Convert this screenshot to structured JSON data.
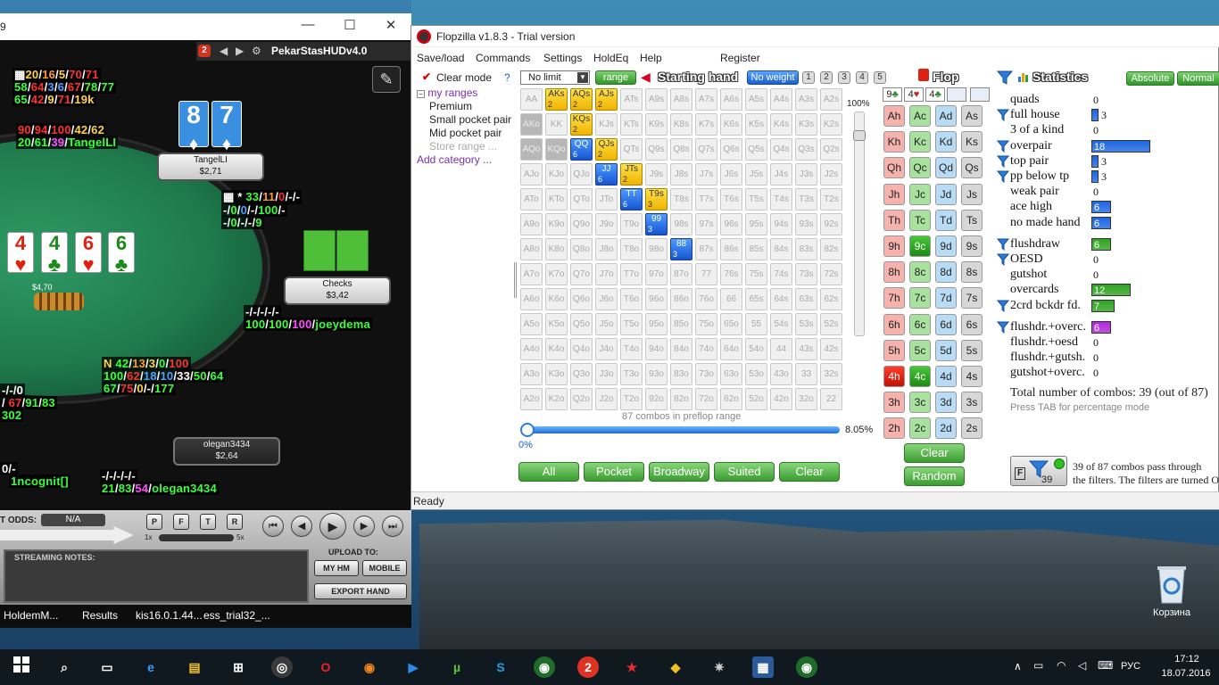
{
  "holdem_manager": {
    "title_fragment": "9",
    "hud_name": "PekarStasHUDv4.0",
    "hud_badge": "2",
    "top_stats": {
      "l1": [
        "20",
        "16",
        "5",
        "70",
        "71"
      ],
      "l2": [
        "58",
        "64",
        "3",
        "6",
        "67",
        "78",
        "77"
      ],
      "l3": [
        "65",
        "42",
        "9",
        "71",
        "19k"
      ]
    },
    "tangel_stats": {
      "l1": [
        "90",
        "94",
        "100",
        "42",
        "62"
      ],
      "l2": [
        "20",
        "61",
        "39",
        "TangelLI"
      ]
    },
    "tangel_plate": {
      "name": "TangelLI",
      "stack": "$2,71"
    },
    "board_cards": [
      {
        "rank": "8",
        "suit": "♦"
      },
      {
        "rank": "7",
        "suit": "♦"
      }
    ],
    "player_cards": [
      {
        "rank": "4",
        "suit": "♥"
      },
      {
        "rank": "4",
        "suit": "♣"
      },
      {
        "rank": "6",
        "suit": "♥"
      },
      {
        "rank": "6",
        "suit": "♣"
      }
    ],
    "joey_stats": {
      "l1": [
        "*",
        "33",
        "11",
        "0",
        "-",
        "-"
      ],
      "l2": [
        "-",
        "/",
        "0",
        "/",
        "0",
        "/",
        "-",
        "/",
        "100",
        "/",
        "-"
      ],
      "l3": [
        "-",
        "/",
        "0",
        "/",
        "-",
        "/",
        "-",
        "/",
        "9"
      ]
    },
    "joey_plate": {
      "status": "Checks",
      "stack": "$3,42"
    },
    "joey_stats2": {
      "l1": "-/-/-/-/-",
      "l2": [
        "100",
        "100",
        "100",
        "joeydema"
      ]
    },
    "pot": "$4,70",
    "olegan_hud": {
      "l1": [
        "42",
        "13",
        "3",
        "0",
        "100"
      ],
      "l2": [
        "100",
        "62",
        "18",
        "10",
        "33",
        "50",
        "64"
      ],
      "l3": [
        "67",
        "75",
        "0",
        "-",
        "177"
      ]
    },
    "left_stats": {
      "l1": "-/-/0",
      "l2": [
        "67",
        "91",
        "83"
      ],
      "l3": "302",
      "l4": "0/-",
      "l5": "1ncognit[]"
    },
    "olegan_plate": {
      "name": "olegan3434",
      "stack": "$2,64"
    },
    "olegan_stats2": {
      "l1": "-/-/-/-/-",
      "l2": [
        "21",
        "83",
        "54",
        "olegan3434"
      ]
    },
    "controls": {
      "pot_odds_label": "T ODDS:",
      "pot_odds": "N/A",
      "p": "P",
      "f": "F",
      "t": "T",
      "r": "R",
      "speed_min": "1x",
      "speed_max": "5x"
    },
    "notes_title": "STREAMING NOTES:",
    "upload_title": "UPLOAD TO:",
    "buttons": {
      "my_hm": "MY HM",
      "mobile": "MOBILE",
      "export": "EXPORT HAND"
    },
    "tabs": [
      "HoldemM...",
      "Results",
      "kis16.0.1.44...",
      "ess_trial32_..."
    ]
  },
  "flopzilla": {
    "title": "Flopzilla v1.8.3 - Trial version",
    "menu": [
      "Save/load",
      "Commands",
      "Settings",
      "HoldEq",
      "Help",
      "Register"
    ],
    "clear_mode": "Clear mode",
    "help_q": "?",
    "limit": "No limit",
    "range_btn": "range",
    "starting_hand": "Starting hand",
    "no_weight": "No weight",
    "weights": [
      "1",
      "2",
      "3",
      "4",
      "5"
    ],
    "tree": [
      "my ranges",
      "Premium",
      "Small pocket pair",
      "Mid pocket pair",
      "Store range ...",
      "Add category ..."
    ],
    "grid": [
      [
        "AA",
        "AKs",
        "AQs",
        "AJs",
        "ATs",
        "A9s",
        "A8s",
        "A7s",
        "A6s",
        "A5s",
        "A4s",
        "A3s",
        "A2s"
      ],
      [
        "AKo",
        "KK",
        "KQs",
        "KJs",
        "KTs",
        "K9s",
        "K8s",
        "K7s",
        "K6s",
        "K5s",
        "K4s",
        "K3s",
        "K2s"
      ],
      [
        "AQo",
        "KQo",
        "QQ",
        "QJs",
        "QTs",
        "Q9s",
        "Q8s",
        "Q7s",
        "Q6s",
        "Q5s",
        "Q4s",
        "Q3s",
        "Q2s"
      ],
      [
        "AJo",
        "KJo",
        "QJo",
        "JJ",
        "JTs",
        "J9s",
        "J8s",
        "J7s",
        "J6s",
        "J5s",
        "J4s",
        "J3s",
        "J2s"
      ],
      [
        "ATo",
        "KTo",
        "QTo",
        "JTo",
        "TT",
        "T9s",
        "T8s",
        "T7s",
        "T6s",
        "T5s",
        "T4s",
        "T3s",
        "T2s"
      ],
      [
        "A9o",
        "K9o",
        "Q9o",
        "J9o",
        "T9o",
        "99",
        "98s",
        "97s",
        "96s",
        "95s",
        "94s",
        "93s",
        "92s"
      ],
      [
        "A8o",
        "K8o",
        "Q8o",
        "J8o",
        "T8o",
        "98o",
        "88",
        "87s",
        "86s",
        "85s",
        "84s",
        "83s",
        "82s"
      ],
      [
        "A7o",
        "K7o",
        "Q7o",
        "J7o",
        "T7o",
        "97o",
        "87o",
        "77",
        "76s",
        "75s",
        "74s",
        "73s",
        "72s"
      ],
      [
        "A6o",
        "K6o",
        "Q6o",
        "J6o",
        "T6o",
        "96o",
        "86o",
        "76o",
        "66",
        "65s",
        "64s",
        "63s",
        "62s"
      ],
      [
        "A5o",
        "K5o",
        "Q5o",
        "J5o",
        "T5o",
        "95o",
        "85o",
        "75o",
        "65o",
        "55",
        "54s",
        "53s",
        "52s"
      ],
      [
        "A4o",
        "K4o",
        "Q4o",
        "J4o",
        "T4o",
        "94o",
        "84o",
        "74o",
        "64o",
        "54o",
        "44",
        "43s",
        "42s"
      ],
      [
        "A3o",
        "K3o",
        "Q3o",
        "J3o",
        "T3o",
        "93o",
        "83o",
        "73o",
        "63o",
        "53o",
        "43o",
        "33",
        "32s"
      ],
      [
        "A2o",
        "K2o",
        "Q2o",
        "J2o",
        "T2o",
        "92o",
        "82o",
        "72o",
        "62o",
        "52o",
        "42o",
        "32o",
        "22"
      ]
    ],
    "grid_highlight": {
      "AKs": "2",
      "AQs": "2",
      "AJs": "2",
      "KQs": "2",
      "QJs": "2",
      "JTs": "2",
      "T9s": "3"
    },
    "grid_blue": {
      "QQ": "6",
      "JJ": "6",
      "TT": "6",
      "99": "3",
      "88": "3"
    },
    "grid_gray": [
      "AKo",
      "AQo",
      "KQo"
    ],
    "percent_top": "100%",
    "combos_label": "87 combos in preflop range",
    "pct_min": "0%",
    "pct_val": "8.05%",
    "quick_buttons": [
      "All",
      "Pocket",
      "Broadway",
      "Suited",
      "Clear"
    ],
    "flop_title": "Flop",
    "flop_cards": [
      {
        "rank": "9",
        "suit": "♣",
        "color": "#2a8a2a"
      },
      {
        "rank": "4",
        "suit": "♥",
        "color": "#d02020"
      },
      {
        "rank": "4",
        "suit": "♣",
        "color": "#2a8a2a"
      }
    ],
    "flop_grid": [
      [
        "Ah",
        "Ac",
        "Ad",
        "As"
      ],
      [
        "Kh",
        "Kc",
        "Kd",
        "Ks"
      ],
      [
        "Qh",
        "Qc",
        "Qd",
        "Qs"
      ],
      [
        "Jh",
        "Jc",
        "Jd",
        "Js"
      ],
      [
        "Th",
        "Tc",
        "Td",
        "Ts"
      ],
      [
        "9h",
        "9c",
        "9d",
        "9s"
      ],
      [
        "8h",
        "8c",
        "8d",
        "8s"
      ],
      [
        "7h",
        "7c",
        "7d",
        "7s"
      ],
      [
        "6h",
        "6c",
        "6d",
        "6s"
      ],
      [
        "5h",
        "5c",
        "5d",
        "5s"
      ],
      [
        "4h",
        "4c",
        "4d",
        "4s"
      ],
      [
        "3h",
        "3c",
        "3d",
        "3s"
      ],
      [
        "2h",
        "2c",
        "2d",
        "2s"
      ]
    ],
    "flop_selected": [
      "9c",
      "4h",
      "4c"
    ],
    "flop_buttons": [
      "Clear",
      "Random"
    ],
    "stats_title": "Statistics",
    "stats_modes": [
      "Absolute",
      "Normal"
    ],
    "stats": [
      {
        "label": "quads",
        "value": "0",
        "bar": 0,
        "color": "#1c66e0",
        "filter": false
      },
      {
        "label": "full house",
        "value": "3",
        "bar": 3,
        "color": "#1c66e0",
        "filter": true
      },
      {
        "label": "3 of a kind",
        "value": "0",
        "bar": 0,
        "color": "#1c66e0",
        "filter": false
      },
      {
        "label": "overpair",
        "value": "18",
        "bar": 18,
        "color": "#1c66e0",
        "filter": true
      },
      {
        "label": "top pair",
        "value": "3",
        "bar": 3,
        "color": "#1c66e0",
        "filter": true
      },
      {
        "label": "pp below tp",
        "value": "3",
        "bar": 3,
        "color": "#1c66e0",
        "filter": true
      },
      {
        "label": "weak pair",
        "value": "0",
        "bar": 0,
        "color": "#1c66e0",
        "filter": false
      },
      {
        "label": "ace high",
        "value": "6",
        "bar": 6,
        "color": "#1c66e0",
        "filter": false
      },
      {
        "label": "no made hand",
        "value": "6",
        "bar": 6,
        "color": "#1c66e0",
        "filter": false
      },
      {
        "label": "flushdraw",
        "value": "6",
        "bar": 6,
        "color": "#2fa321",
        "filter": true
      },
      {
        "label": "OESD",
        "value": "0",
        "bar": 0,
        "color": "#2fa321",
        "filter": true
      },
      {
        "label": "gutshot",
        "value": "0",
        "bar": 0,
        "color": "#2fa321",
        "filter": false
      },
      {
        "label": "overcards",
        "value": "12",
        "bar": 12,
        "color": "#2fa321",
        "filter": false
      },
      {
        "label": "2crd bckdr fd.",
        "value": "7",
        "bar": 7,
        "color": "#2fa321",
        "filter": true
      },
      {
        "label": "flushdr.+overc.",
        "value": "6",
        "bar": 6,
        "color": "#b026d8",
        "filter": true
      },
      {
        "label": "flushdr.+oesd",
        "value": "0",
        "bar": 0,
        "color": "#b026d8",
        "filter": false
      },
      {
        "label": "flushdr.+gutsh.",
        "value": "0",
        "bar": 0,
        "color": "#b026d8",
        "filter": false
      },
      {
        "label": "gutshot+overc.",
        "value": "0",
        "bar": 0,
        "color": "#b026d8",
        "filter": false
      }
    ],
    "total_combos": "Total number of combos: 39 (out of 87)",
    "tab_hint": "Press TAB for percentage mode",
    "filter_count": "39",
    "filter_text1": "39 of 87 combos pass through",
    "filter_text2": "the filters. The filters are turned O",
    "status": "Ready"
  },
  "desktop": {
    "recycle_bin": "Корзина"
  },
  "taskbar": {
    "lang": "РУС",
    "time": "17:12",
    "date": "18.07.2016"
  }
}
